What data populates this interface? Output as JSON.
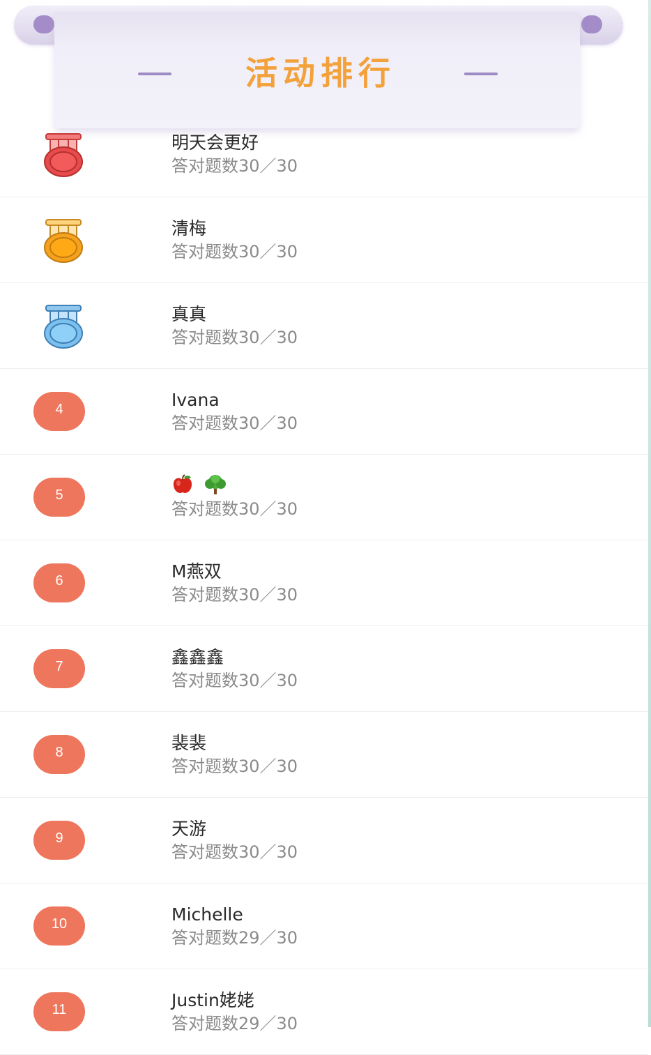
{
  "banner": {
    "title": "活动排行"
  },
  "leaderboard": [
    {
      "rank": "1",
      "medal": "red-medal-icon",
      "name": "明天会更好",
      "score": "答对题数30／30"
    },
    {
      "rank": "2",
      "medal": "gold-medal-icon",
      "name": "清梅",
      "score": "答对题数30／30"
    },
    {
      "rank": "3",
      "medal": "blue-medal-icon",
      "name": "真真",
      "score": "答对题数30／30"
    },
    {
      "rank": "4",
      "name": "Ivana",
      "score": "答对题数30／30"
    },
    {
      "rank": "5",
      "name_icons": [
        "apple-icon",
        "tree-icon"
      ],
      "score": "答对题数30／30"
    },
    {
      "rank": "6",
      "name": "M燕双",
      "score": "答对题数30／30"
    },
    {
      "rank": "7",
      "name": "鑫鑫鑫",
      "score": "答对题数30／30"
    },
    {
      "rank": "8",
      "name": "裴裴",
      "score": "答对题数30／30"
    },
    {
      "rank": "9",
      "name": "天游",
      "score": "答对题数30／30"
    },
    {
      "rank": "10",
      "name": "Michelle",
      "score": "答对题数29／30"
    },
    {
      "rank": "11",
      "name": "Justin姥姥",
      "score": "答对题数29／30"
    }
  ],
  "colors": {
    "title": "#f3a13b",
    "badge": "#ee765c",
    "banner": "#a38cc8"
  }
}
